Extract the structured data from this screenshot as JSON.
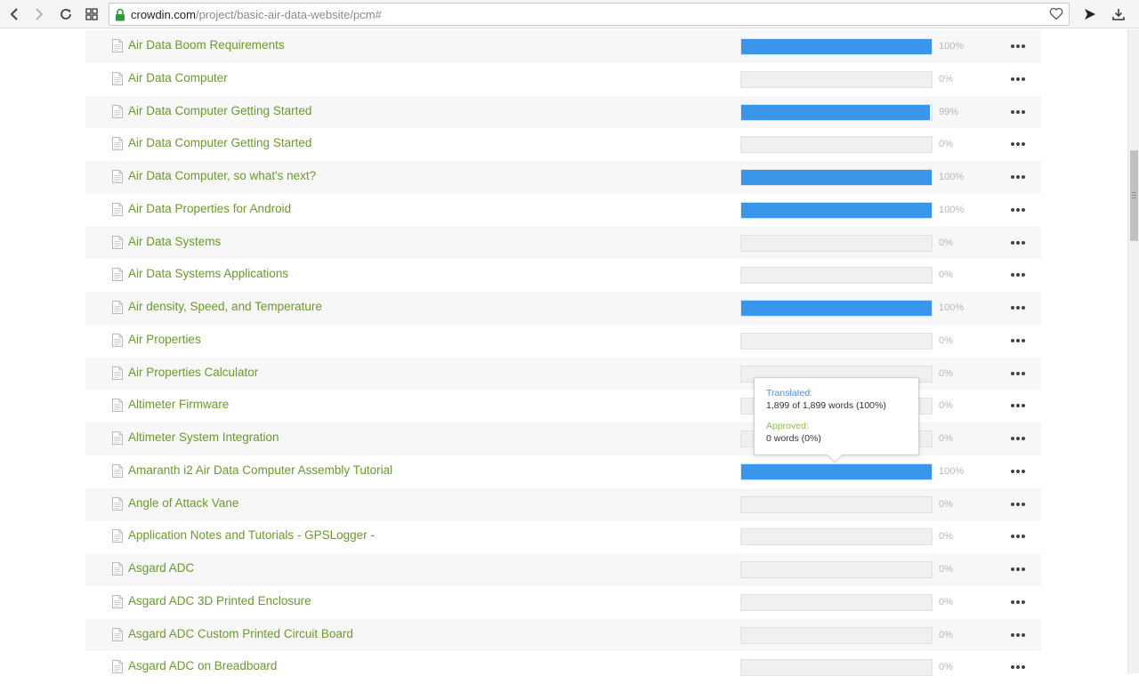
{
  "browser": {
    "url_host": "crowdin.com",
    "url_path": "/project/basic-air-data-website/pcm#"
  },
  "colors": {
    "progress_fill": "#3b95e8",
    "file_name": "#6a9a2c",
    "translated_label": "#4a90d9",
    "approved_label": "#8cbf3f"
  },
  "files": [
    {
      "name": "Air Data Boom Requirements",
      "percent": "100%",
      "progress": 1.0
    },
    {
      "name": "Air Data Computer",
      "percent": "0%",
      "progress": 0
    },
    {
      "name": "Air Data Computer Getting Started",
      "percent": "99%",
      "progress": 0.99
    },
    {
      "name": "Air Data Computer Getting Started",
      "percent": "0%",
      "progress": 0
    },
    {
      "name": "Air Data Computer, so what's next?",
      "percent": "100%",
      "progress": 1.0
    },
    {
      "name": "Air Data Properties for Android",
      "percent": "100%",
      "progress": 1.0
    },
    {
      "name": "Air Data Systems",
      "percent": "0%",
      "progress": 0
    },
    {
      "name": "Air Data Systems Applications",
      "percent": "0%",
      "progress": 0
    },
    {
      "name": "Air density, Speed, and Temperature",
      "percent": "100%",
      "progress": 1.0
    },
    {
      "name": "Air Properties",
      "percent": "0%",
      "progress": 0
    },
    {
      "name": "Air Properties Calculator",
      "percent": "0%",
      "progress": 0
    },
    {
      "name": "Altimeter Firmware",
      "percent": "0%",
      "progress": 0
    },
    {
      "name": "Altimeter System Integration",
      "percent": "0%",
      "progress": 0
    },
    {
      "name": "Amaranth i2 Air Data Computer Assembly Tutorial",
      "percent": "100%",
      "progress": 1.0
    },
    {
      "name": "Angle of Attack Vane",
      "percent": "0%",
      "progress": 0
    },
    {
      "name": "Application Notes and Tutorials - GPSLogger -",
      "percent": "0%",
      "progress": 0
    },
    {
      "name": "Asgard ADC",
      "percent": "0%",
      "progress": 0
    },
    {
      "name": "Asgard ADC 3D Printed Enclosure",
      "percent": "0%",
      "progress": 0
    },
    {
      "name": "Asgard ADC Custom Printed Circuit Board",
      "percent": "0%",
      "progress": 0
    },
    {
      "name": "Asgard ADC on Breadboard",
      "percent": "0%",
      "progress": 0
    }
  ],
  "tooltip": {
    "translated_label": "Translated:",
    "translated_value": "1,899 of 1,899 words (100%)",
    "approved_label": "Approved:",
    "approved_value": "0 words (0%)"
  }
}
